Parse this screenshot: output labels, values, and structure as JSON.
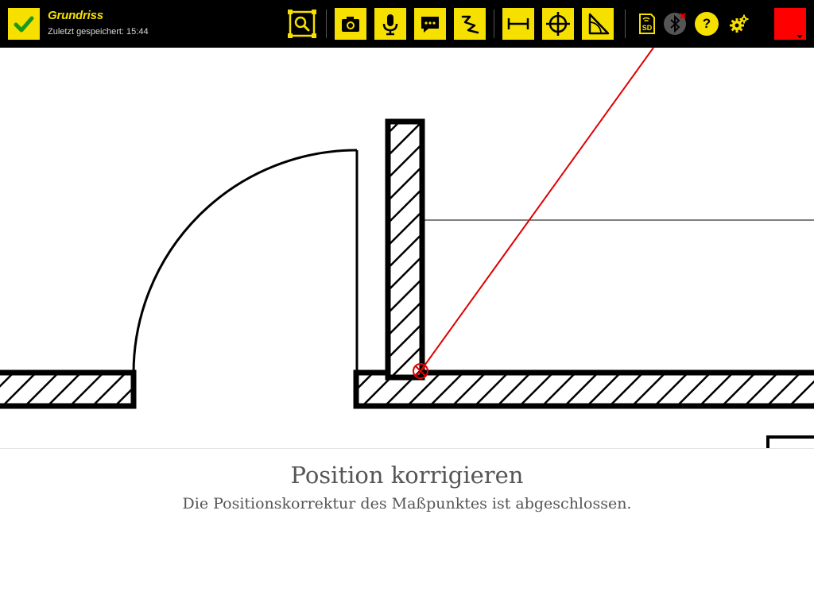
{
  "app": {
    "document_title": "Grundriss",
    "last_saved": "Zuletzt gespeichert: 15:44"
  },
  "toolbar": {
    "confirm_icon": "checkmark-icon",
    "tools": [
      {
        "id": "zoom-fit",
        "icon": "zoom-fit-icon"
      },
      {
        "id": "camera",
        "icon": "camera-icon"
      },
      {
        "id": "voice",
        "icon": "microphone-icon"
      },
      {
        "id": "comment",
        "icon": "comment-icon"
      },
      {
        "id": "freehand",
        "icon": "freehand-icon"
      },
      {
        "id": "measure",
        "icon": "measure-distance-icon"
      },
      {
        "id": "point",
        "icon": "crosshair-icon"
      },
      {
        "id": "angle",
        "icon": "angle-icon"
      }
    ],
    "status": {
      "sd_card_label": "SD",
      "bluetooth": "disconnected",
      "help_label": "?"
    },
    "active_color": "#ff0000"
  },
  "colors": {
    "accent": "#f5e000",
    "toolbar_bg": "#000000",
    "measure_line": "#e00000"
  },
  "panel": {
    "title": "Position korrigieren",
    "message": "Die Positionskorrektur des Maßpunktes ist abgeschlossen."
  }
}
